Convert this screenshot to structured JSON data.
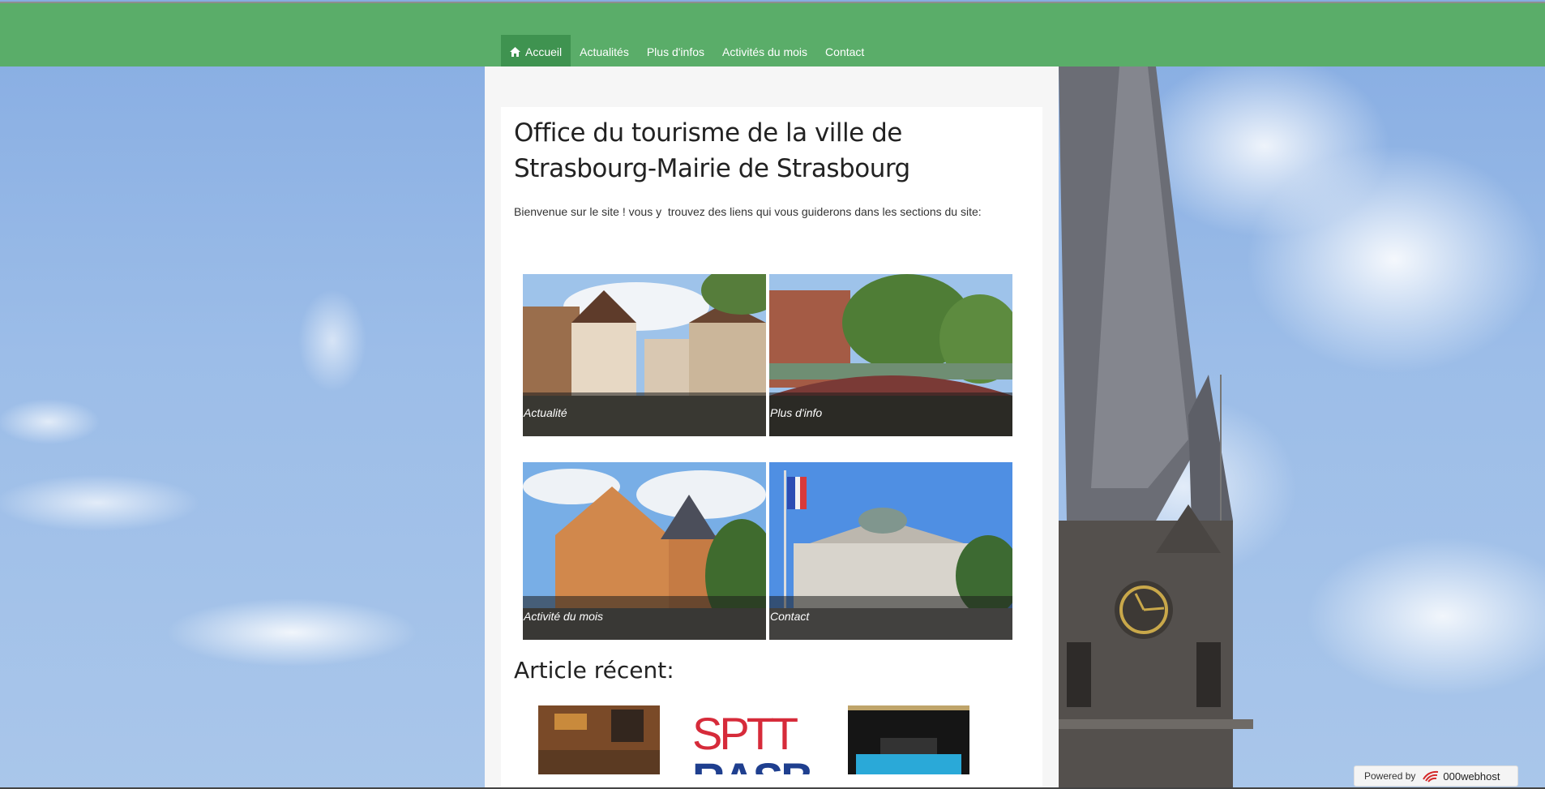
{
  "nav": {
    "items": [
      {
        "label": "Accueil",
        "icon": "home-icon",
        "active": true
      },
      {
        "label": "Actualités"
      },
      {
        "label": "Plus d'infos"
      },
      {
        "label": "Activités du mois"
      },
      {
        "label": "Contact"
      }
    ]
  },
  "main": {
    "title": "Office du tourisme de la ville de Strasbourg-Mairie de Strasbourg",
    "intro": "Bienvenue sur le site ! vous y  trouvez des liens qui vous guiderons dans les sections du site:",
    "tiles": [
      {
        "label": "Actualité"
      },
      {
        "label": "Plus d'info"
      },
      {
        "label": "Activité du mois"
      },
      {
        "label": "Contact"
      }
    ],
    "recent_title": "Article récent:",
    "recent_thumb_text": "SPT RASB"
  },
  "footer": {
    "powered_by": "Powered by",
    "brand": "000webhost"
  },
  "colors": {
    "nav_bg": "#5aad69",
    "nav_active": "#3f9350"
  }
}
